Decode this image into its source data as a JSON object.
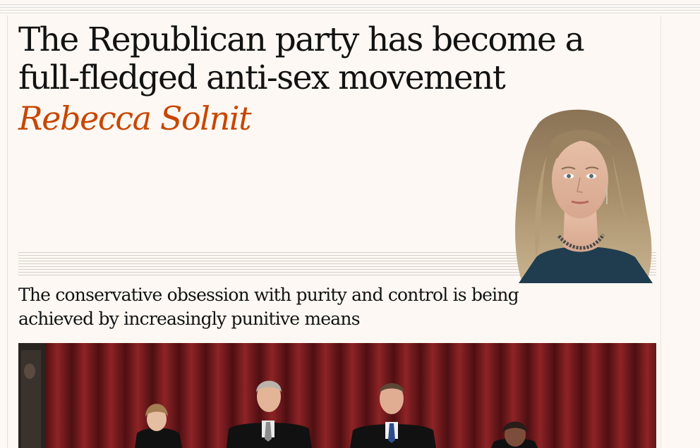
{
  "article": {
    "headline": "The Republican party has become a full-fledged anti-sex movement",
    "author": "Rebecca Solnit",
    "standfirst": "The conservative obsession with purity and control is being achieved by increasingly punitive means"
  },
  "colors": {
    "background": "#fdf8f3",
    "byline": "#c74600",
    "text": "#121212",
    "curtain": "#7a1d20"
  },
  "images": {
    "author_portrait": "author-cutout-portrait",
    "main_photo": "justices-in-robes-before-red-curtain"
  }
}
